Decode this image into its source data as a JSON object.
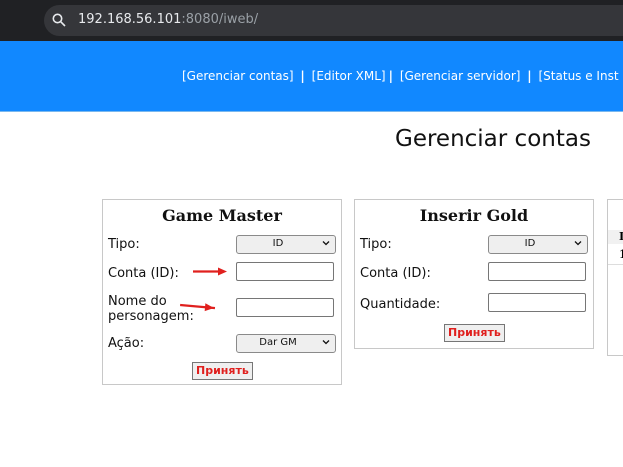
{
  "browser": {
    "url_host": "192.168.56.101",
    "url_rest": ":8080/iweb/"
  },
  "nav": {
    "items": [
      "[Gerenciar contas]",
      "[Editor XML]",
      "[Gerenciar servidor]",
      "[Status e Inst"
    ],
    "separator": "|"
  },
  "page": {
    "title": "Gerenciar contas"
  },
  "game_master": {
    "title": "Game Master",
    "tipo_label": "Tipo:",
    "tipo_value": "ID",
    "conta_label": "Conta (ID):",
    "nome_label_line1": "Nome do",
    "nome_label_line2": "personagem:",
    "acao_label": "Ação:",
    "acao_value": "Dar GM",
    "submit": "Принять"
  },
  "inserir_gold": {
    "title": "Inserir Gold",
    "tipo_label": "Tipo:",
    "tipo_value": "ID",
    "conta_label": "Conta (ID):",
    "quantidade_label": "Quantidade:",
    "submit": "Принять"
  },
  "partial_panel": {
    "header_char": "I",
    "row_char": "1"
  },
  "colors": {
    "header_blue": "#1188ff",
    "submit_red": "#e0201e",
    "arrow_red": "#e0201e"
  },
  "icons": [
    "search-icon",
    "chevron-down-icon",
    "arrow-right-icon"
  ]
}
